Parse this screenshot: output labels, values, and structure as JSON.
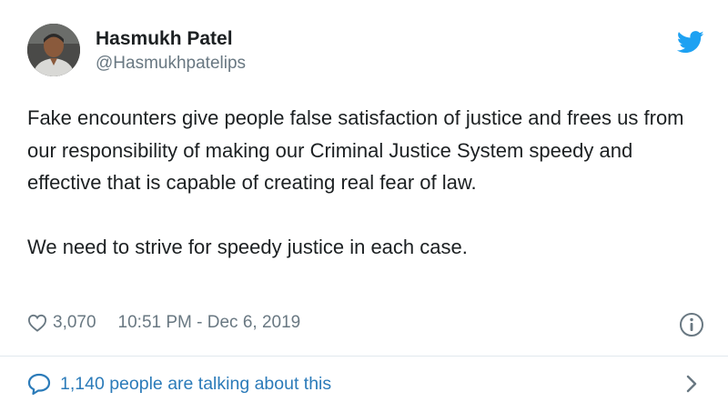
{
  "tweet": {
    "author": {
      "display_name": "Hasmukh Patel",
      "handle": "@Hasmukhpatelips"
    },
    "text_paragraphs": [
      "Fake encounters give people false satisfaction of justice and frees us from our responsibility of making our Criminal Justice System speedy and effective that is capable of creating real fear of law.",
      "We need to strive for speedy justice in each case."
    ],
    "likes": "3,070",
    "timestamp": "10:51 PM - Dec 6, 2019",
    "conversation_label": "1,140 people are talking about this"
  },
  "icons": {
    "brand": "twitter-bird-icon",
    "like": "heart-icon",
    "info": "info-icon",
    "conversation": "speech-bubble-icon",
    "more": "chevron-right-icon"
  },
  "colors": {
    "twitter_blue": "#1da1f2",
    "link_blue": "#2b7bb9",
    "secondary_text": "#697882",
    "primary_text": "#1c2022",
    "divider": "#e1e8ed"
  }
}
